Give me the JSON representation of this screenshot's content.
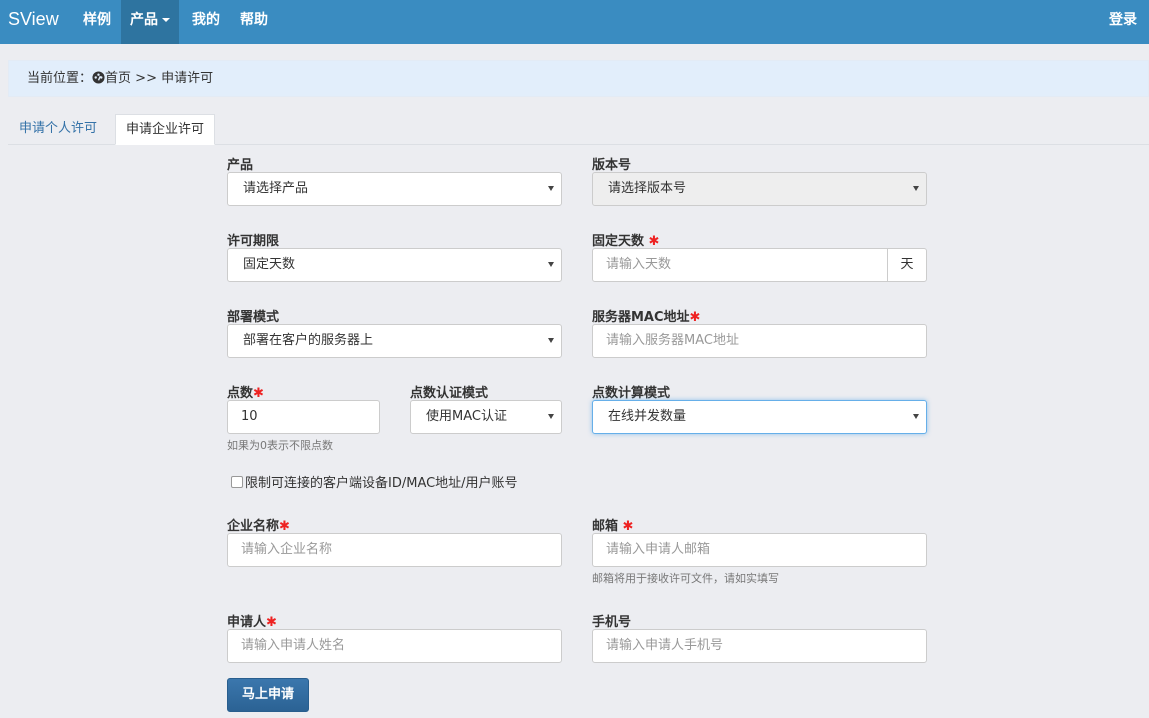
{
  "navbar": {
    "brand": "SView",
    "items": [
      {
        "label": "样例"
      },
      {
        "label": "产品"
      },
      {
        "label": "我的"
      },
      {
        "label": "帮助"
      }
    ],
    "login": "登录"
  },
  "breadcrumb": {
    "prefix": "当前位置：",
    "home": "首页",
    "separator": ">>",
    "current": "申请许可"
  },
  "tabs": [
    {
      "label": "申请个人许可",
      "active": false
    },
    {
      "label": "申请企业许可",
      "active": true
    }
  ],
  "form": {
    "product": {
      "label": "产品",
      "value": "请选择产品"
    },
    "version": {
      "label": "版本号",
      "value": "请选择版本号"
    },
    "license_term": {
      "label": "许可期限",
      "value": "固定天数"
    },
    "fixed_days": {
      "label": "固定天数",
      "placeholder": "请输入天数",
      "unit": "天"
    },
    "deploy_mode": {
      "label": "部署模式",
      "value": "部署在客户的服务器上"
    },
    "server_mac": {
      "label": "服务器MAC地址",
      "placeholder": "请输入服务器MAC地址"
    },
    "points": {
      "label": "点数",
      "value": "10",
      "help": "如果为0表示不限点数"
    },
    "points_auth": {
      "label": "点数认证模式",
      "value": "使用MAC认证"
    },
    "points_calc": {
      "label": "点数计算模式",
      "value": "在线并发数量"
    },
    "restrict_checkbox": {
      "label": "限制可连接的客户端设备ID/MAC地址/用户账号",
      "checked": false
    },
    "company": {
      "label": "企业名称",
      "placeholder": "请输入企业名称"
    },
    "email": {
      "label": "邮箱",
      "placeholder": "请输入申请人邮箱",
      "help": "邮箱将用于接收许可文件，请如实填写"
    },
    "applicant": {
      "label": "申请人",
      "placeholder": "请输入申请人姓名"
    },
    "phone": {
      "label": "手机号",
      "placeholder": "请输入申请人手机号"
    },
    "required_mark": "✱",
    "submit": "马上申请"
  },
  "colors": {
    "navbar": "#3a8cc1",
    "navbar_active": "#2e74a0",
    "breadcrumb_bg": "#e2eefb",
    "primary_button": "#2b6294",
    "required": "#e22222"
  }
}
